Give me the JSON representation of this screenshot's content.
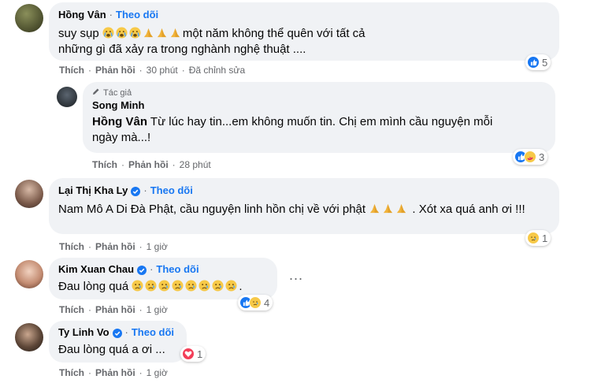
{
  "comments": [
    {
      "author": "Hồng Vân",
      "follow": "Theo dõi",
      "text_prefix": "suy sụp",
      "text_suffix": "một năm không thể quên với tất cả những gì đã xảy ra trong nghành nghệ thuật ....",
      "like": "Thích",
      "reply": "Phản hồi",
      "time": "30 phút",
      "edited": "Đã chỉnh sửa",
      "reaction_count": "5"
    },
    {
      "author_tag": "Tác giả",
      "author": "Song Minh",
      "mention": "Hồng Vân",
      "text": "Từ lúc hay tin...em không muốn tin. Chị em mình cầu nguyện mỗi ngày mà...!",
      "like": "Thích",
      "reply": "Phản hồi",
      "time": "28 phút",
      "reaction_count": "3"
    },
    {
      "author": "Lại Thị Kha Ly",
      "follow": "Theo dõi",
      "text_prefix": "Nam Mô A Di Đà Phật, cầu nguyện linh hồn chị về với phật",
      "text_suffix": ". Xót xa quá anh ơi !!!",
      "like": "Thích",
      "reply": "Phản hồi",
      "time": "1 giờ",
      "reaction_count": "1"
    },
    {
      "author": "Kim Xuan Chau",
      "follow": "Theo dõi",
      "text": "Đau lòng quá",
      "text_suffix": ".",
      "like": "Thích",
      "reply": "Phản hồi",
      "time": "1 giờ",
      "reaction_count": "4",
      "more": "..."
    },
    {
      "author": "Ty Linh Vo",
      "follow": "Theo dõi",
      "text": "Đau lòng quá a ơi ...",
      "like": "Thích",
      "reply": "Phản hồi",
      "time": "1 giờ",
      "reaction_count": "1"
    }
  ],
  "separator": "·",
  "colors": {
    "link": "#1877f2",
    "bubble": "#f0f2f5",
    "muted": "#65676b",
    "verified": "#1877f2"
  }
}
